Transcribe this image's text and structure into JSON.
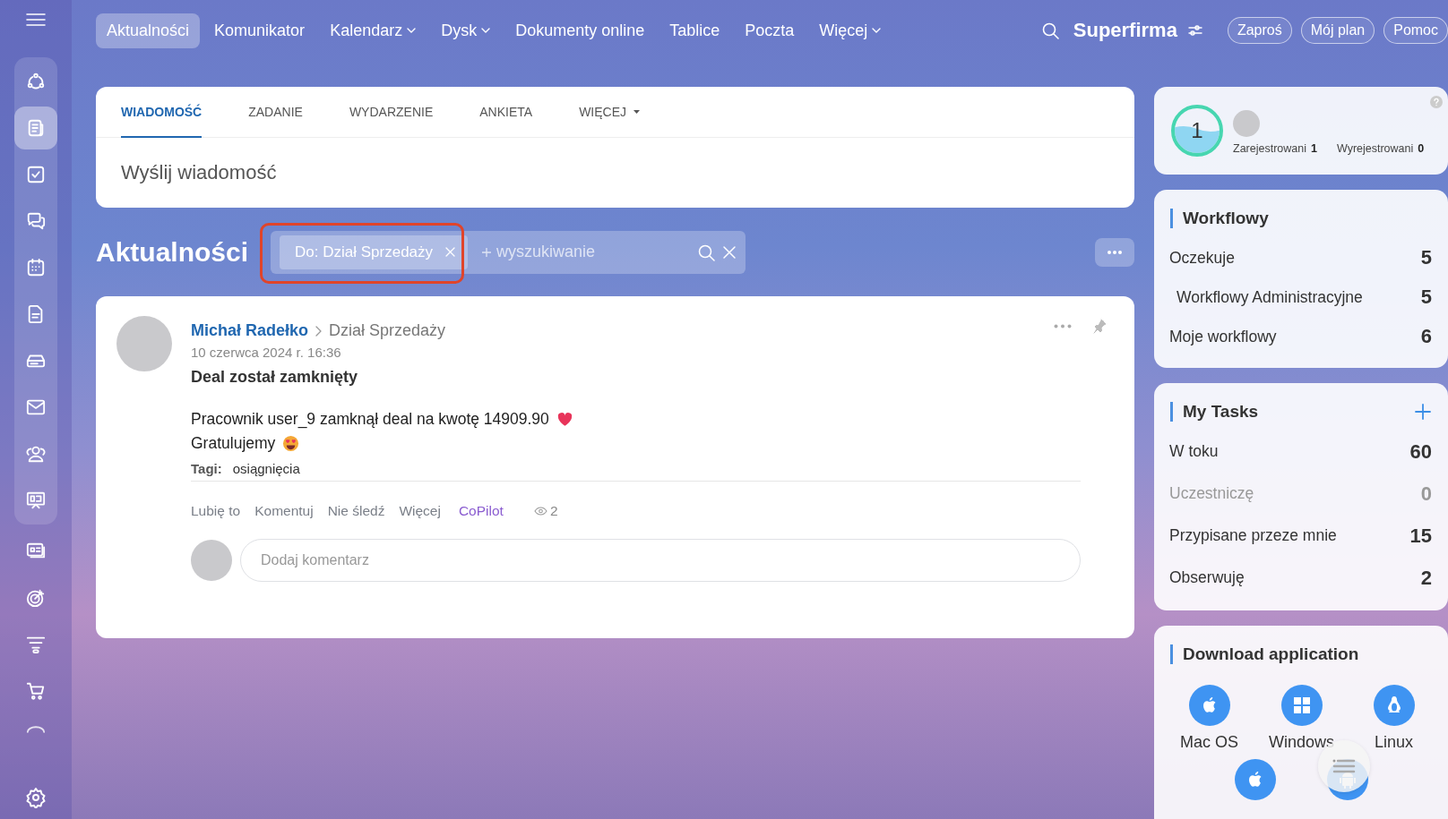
{
  "topbar": {
    "tabs": [
      {
        "label": "Aktualności",
        "selected": true,
        "dropdown": false
      },
      {
        "label": "Komunikator",
        "selected": false,
        "dropdown": false
      },
      {
        "label": "Kalendarz",
        "selected": false,
        "dropdown": true
      },
      {
        "label": "Dysk",
        "selected": false,
        "dropdown": true
      },
      {
        "label": "Dokumenty online",
        "selected": false,
        "dropdown": false
      },
      {
        "label": "Tablice",
        "selected": false,
        "dropdown": false
      },
      {
        "label": "Poczta",
        "selected": false,
        "dropdown": false
      },
      {
        "label": "Więcej",
        "selected": false,
        "dropdown": true
      }
    ],
    "brand": "Superfirma",
    "buttons": [
      "Zaproś",
      "Mój plan",
      "Pomoc"
    ]
  },
  "sidebar": {
    "items": [
      {
        "selected": false
      },
      {
        "selected": true
      },
      {
        "selected": false
      },
      {
        "selected": false
      },
      {
        "selected": false
      },
      {
        "selected": false
      },
      {
        "selected": false
      },
      {
        "selected": false
      },
      {
        "selected": false
      },
      {
        "selected": false
      },
      {
        "selected": false
      },
      {
        "selected": false
      },
      {
        "selected": false
      },
      {
        "selected": false
      },
      {
        "selected": false
      }
    ]
  },
  "composer": {
    "tabs": [
      {
        "label": "WIADOMOŚĆ",
        "selected": true,
        "dropdown": false
      },
      {
        "label": "ZADANIE",
        "selected": false,
        "dropdown": false
      },
      {
        "label": "WYDARZENIE",
        "selected": false,
        "dropdown": false
      },
      {
        "label": "ANKIETA",
        "selected": false,
        "dropdown": false
      },
      {
        "label": "WIĘCEJ",
        "selected": false,
        "dropdown": true
      }
    ],
    "placeholder": "Wyślij wiadomość"
  },
  "feed": {
    "title": "Aktualności",
    "filter": {
      "chip": "Do: Dział Sprzedaży",
      "highlighted": true
    },
    "search": {
      "placeholder": "wyszukiwanie"
    }
  },
  "post": {
    "author": "Michał Radełko",
    "destination": "Dział Sprzedaży",
    "date": "10 czerwca 2024 r. 16:36",
    "title": "Deal został zamknięty",
    "body": [
      {
        "text": "Pracownik user_9 zamknął deal na kwotę 14909.90",
        "kind": "heart"
      },
      {
        "text": "Gratulujemy",
        "kind": "smiley"
      }
    ],
    "tags_label": "Tagi:",
    "tags": [
      "osiągnięcia"
    ],
    "actions": [
      {
        "label": "Lubię to",
        "kind": "plain"
      },
      {
        "label": "Komentuj",
        "kind": "plain"
      },
      {
        "label": "Nie śledź",
        "kind": "plain"
      },
      {
        "label": "Więcej",
        "kind": "plain"
      },
      {
        "label": "CoPilot",
        "kind": "accent"
      }
    ],
    "views": "2",
    "comment_placeholder": "Dodaj komentarz"
  },
  "widgets": {
    "registration": {
      "count": "1",
      "registered_label": "Zarejestrowani",
      "registered": "1",
      "unregistered_label": "Wyrejestrowani",
      "unregistered": "0"
    },
    "workflows": {
      "title": "Workflowy",
      "rows": [
        {
          "label": "Oczekuje",
          "count": "5",
          "children": [
            {
              "label": "Workflowy Administracyjne",
              "count": "5"
            }
          ]
        },
        {
          "label": "Moje workflowy",
          "count": "6"
        }
      ]
    },
    "tasks": {
      "title": "My Tasks",
      "rows": [
        {
          "label": "W toku",
          "count": "60",
          "muted": false
        },
        {
          "label": "Uczestniczę",
          "count": "0",
          "muted": true
        },
        {
          "label": "Przypisane przeze mnie",
          "count": "15",
          "muted": false
        },
        {
          "label": "Obserwuję",
          "count": "2",
          "muted": false
        }
      ]
    },
    "download": {
      "title": "Download application",
      "apps": [
        {
          "label": "Mac OS",
          "kind": "apple"
        },
        {
          "label": "Windows",
          "kind": "windows"
        },
        {
          "label": "Linux",
          "kind": "linux"
        },
        {
          "kind": "apple"
        },
        {
          "kind": "android"
        }
      ]
    }
  }
}
